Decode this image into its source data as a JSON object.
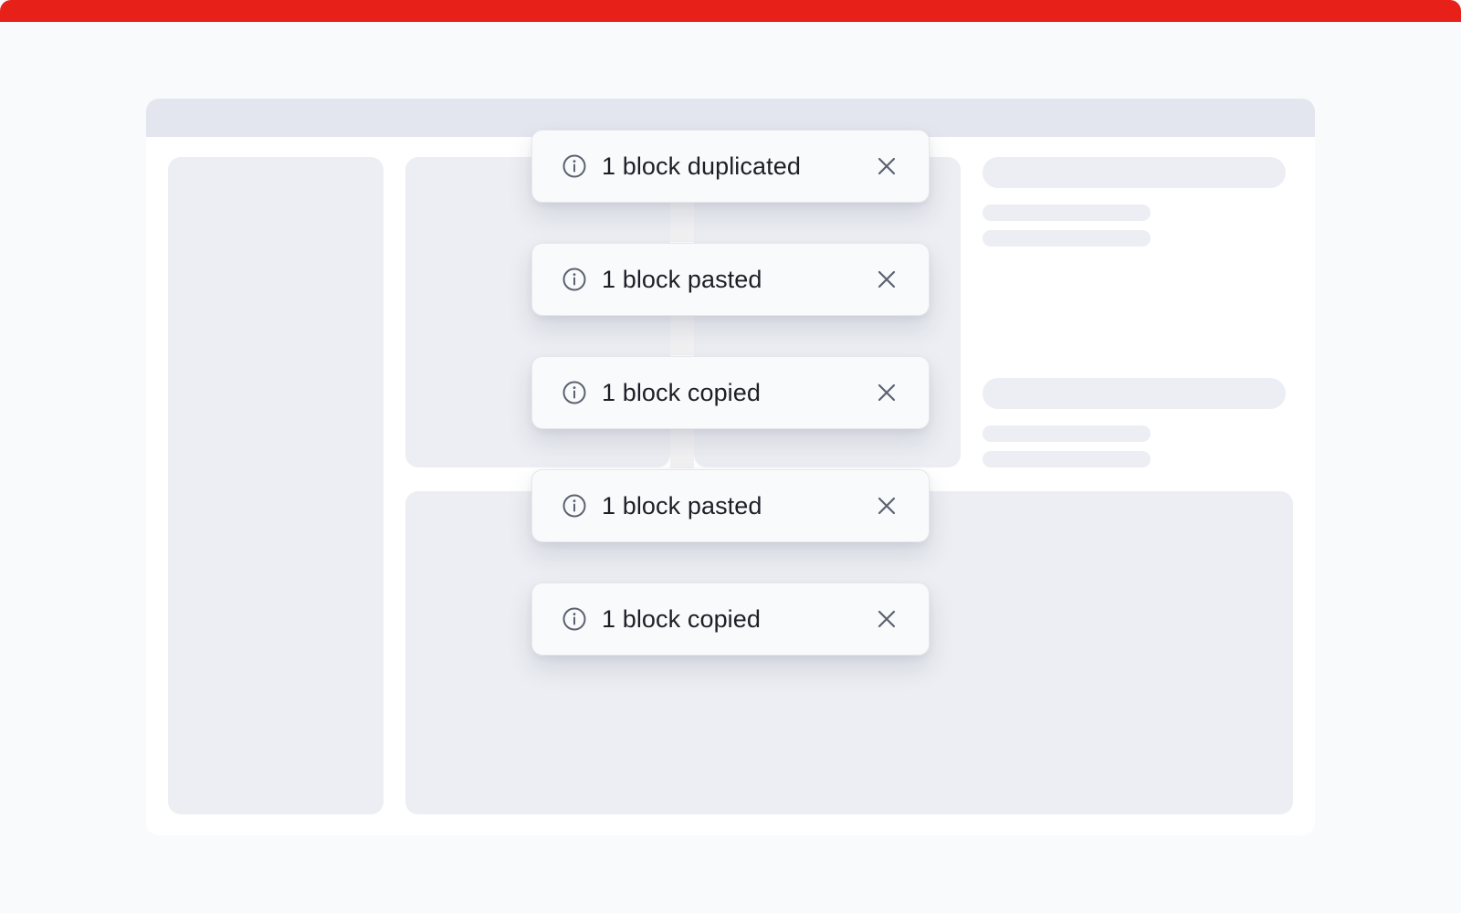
{
  "colors": {
    "accent_bar": "#e8201a",
    "page_background": "#f9fafc",
    "skeleton": "#eceef3",
    "titlebar": "#e3e6ee",
    "toast_background": "#f9fafb",
    "toast_text": "#1c1f26",
    "icon": "#5b6270"
  },
  "toasts": [
    {
      "message": "1 block duplicated",
      "icon": "info-icon",
      "close_icon": "close-icon"
    },
    {
      "message": "1 block pasted",
      "icon": "info-icon",
      "close_icon": "close-icon"
    },
    {
      "message": "1 block copied",
      "icon": "info-icon",
      "close_icon": "close-icon"
    },
    {
      "message": "1 block pasted",
      "icon": "info-icon",
      "close_icon": "close-icon"
    },
    {
      "message": "1 block copied",
      "icon": "info-icon",
      "close_icon": "close-icon"
    }
  ]
}
